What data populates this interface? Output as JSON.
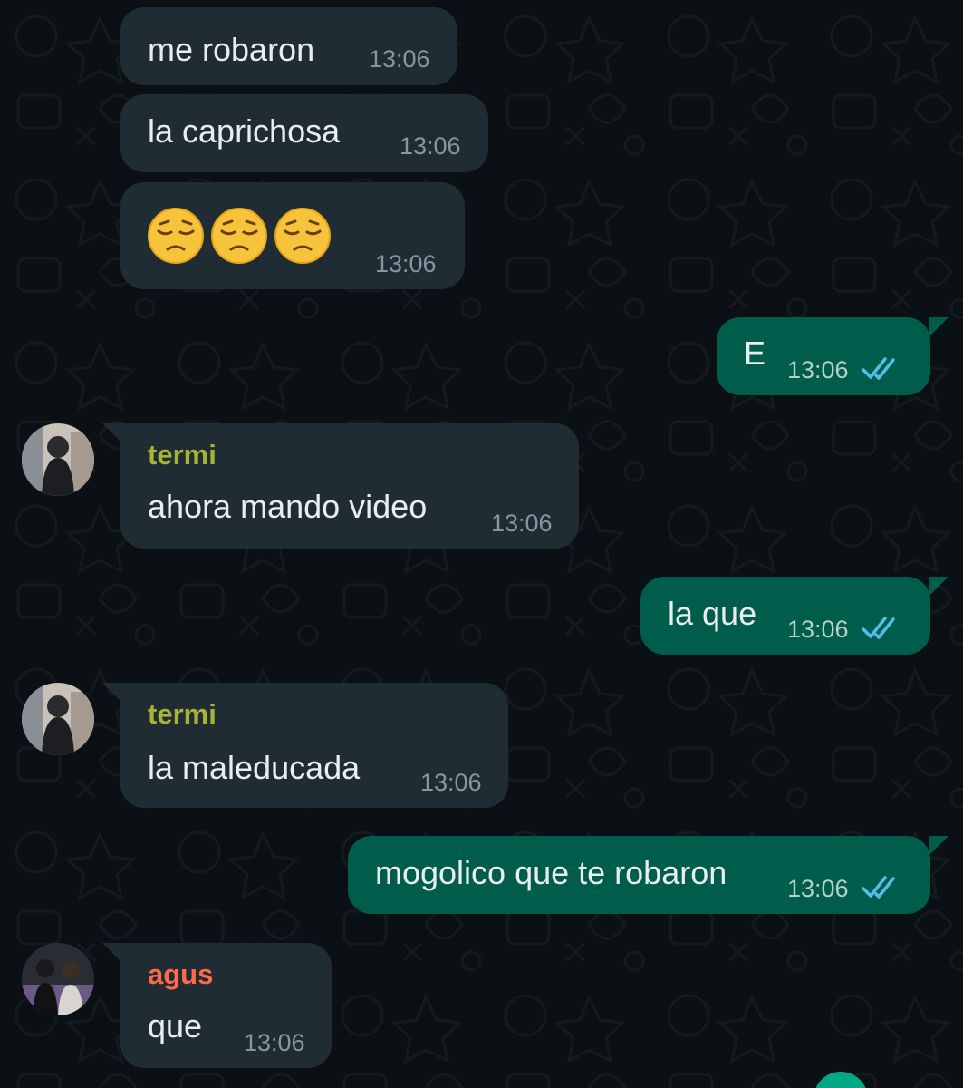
{
  "colors": {
    "background": "#0b1014",
    "incoming_bubble": "#202c33",
    "outgoing_bubble": "#005c4b",
    "sender_termi": "#a5b337",
    "sender_agus": "#fc6c4b",
    "read_ticks": "#53bdeb"
  },
  "messages": [
    {
      "direction": "in",
      "text": "me robaron",
      "time": "13:06"
    },
    {
      "direction": "in",
      "text": "la caprichosa",
      "time": "13:06"
    },
    {
      "direction": "in",
      "emoji": "pensive-face-emoji x3",
      "time": "13:06"
    },
    {
      "direction": "out",
      "text": "E",
      "time": "13:06",
      "status": "read"
    },
    {
      "direction": "in",
      "sender": "termi",
      "text": "ahora mando video",
      "time": "13:06"
    },
    {
      "direction": "out",
      "text": "la que",
      "time": "13:06",
      "status": "read"
    },
    {
      "direction": "in",
      "sender": "termi",
      "text": "la maleducada",
      "time": "13:06"
    },
    {
      "direction": "out",
      "text": "mogolico que te robaron",
      "time": "13:06",
      "status": "read"
    },
    {
      "direction": "in",
      "sender": "agus",
      "text": "que",
      "time": "13:06"
    }
  ]
}
